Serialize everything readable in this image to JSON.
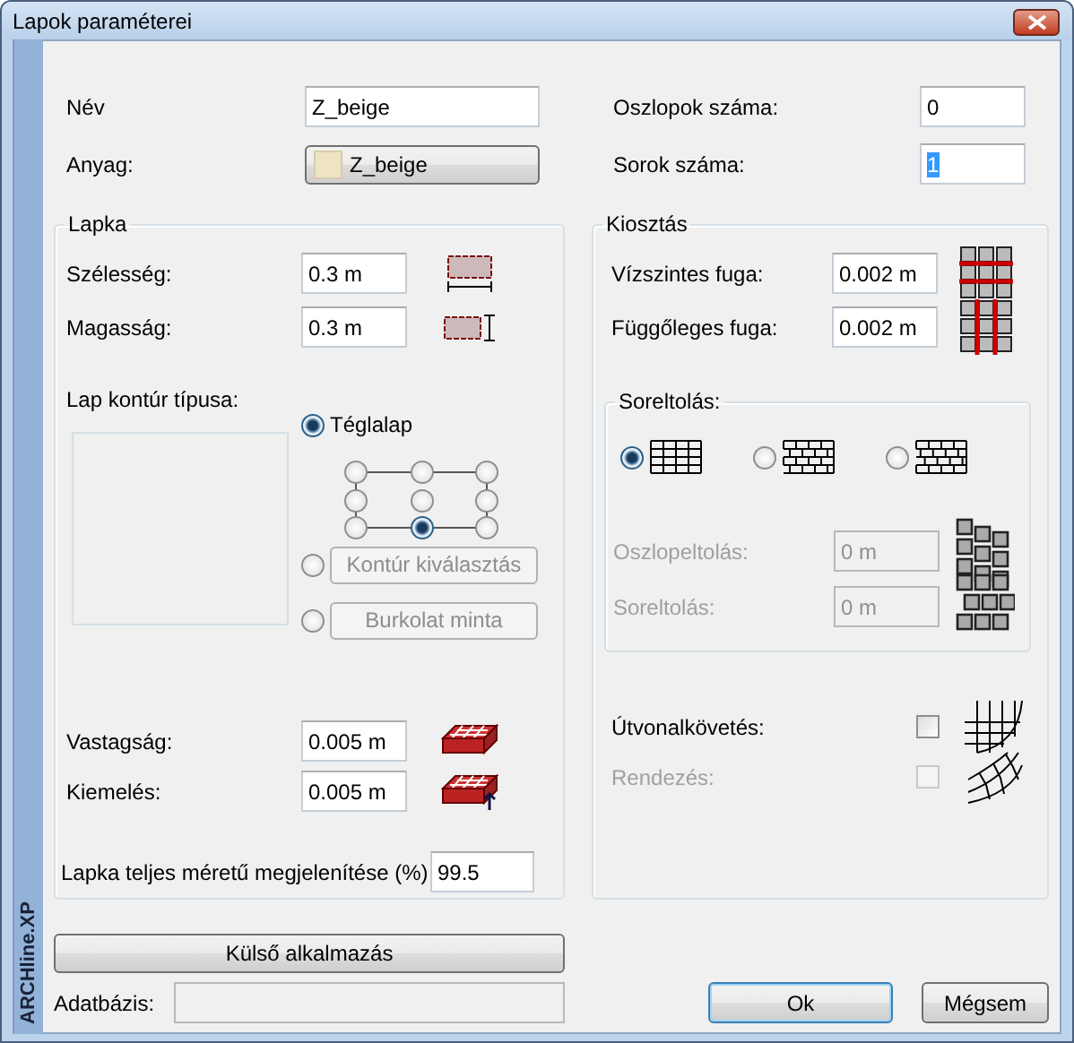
{
  "window": {
    "title": "Lapok paraméterei"
  },
  "side_label": "ARCHline.XP",
  "name_field": {
    "label": "Név",
    "value": "Z_beige"
  },
  "material": {
    "label": "Anyag:",
    "button": "Z_beige"
  },
  "columns_count": {
    "label": "Oszlopok száma:",
    "value": "0"
  },
  "rows_count": {
    "label": "Sorok száma:",
    "value": "1",
    "selected": true
  },
  "tile": {
    "title": "Lapka",
    "fields": [
      {
        "kind": "width",
        "label": "Szélesség:",
        "value": "0.3 m"
      },
      {
        "kind": "height",
        "label": "Magasság:",
        "value": "0.3 m"
      }
    ],
    "contour": {
      "label": "Lap kontúr típusa:",
      "shapes": [
        {
          "kind": "text",
          "label": "Téglalap",
          "selected": true,
          "disabled": false
        },
        {
          "kind": "button",
          "label": "Kontúr kiválasztás",
          "selected": false,
          "disabled": true
        },
        {
          "kind": "button",
          "label": "Burkolat minta",
          "selected": false,
          "disabled": true
        }
      ],
      "anchors": [
        {
          "selected": false
        },
        {
          "selected": false
        },
        {
          "selected": false
        },
        {
          "selected": false
        },
        {
          "selected": false
        },
        {
          "selected": false
        },
        {
          "selected": false
        },
        {
          "selected": true
        },
        {
          "selected": false
        }
      ]
    },
    "depth_fields": [
      {
        "kind": "thickness",
        "label": "Vastagság:",
        "value": "0.005 m"
      },
      {
        "kind": "elevation",
        "label": "Kiemelés:",
        "value": "0.005 m"
      }
    ],
    "full_size": {
      "label": "Lapka teljes méretű megjelenítése (%)",
      "value": "99.5"
    }
  },
  "layout": {
    "title": "Kiosztás",
    "joints": [
      {
        "kind": "horizontal",
        "label": "Vízszintes fuga:",
        "value": "0.002 m"
      },
      {
        "kind": "vertical",
        "label": "Függőleges fuga:",
        "value": "0.002 m"
      }
    ],
    "offset": {
      "title": "Soreltolás:",
      "patterns": [
        {
          "kind": "grid",
          "selected": true
        },
        {
          "kind": "half",
          "selected": false
        },
        {
          "kind": "third",
          "selected": false
        }
      ],
      "fields": [
        {
          "kind": "column",
          "label": "Oszlopeltolás:",
          "value": "0 m",
          "disabled": true
        },
        {
          "kind": "row",
          "label": "Soreltolás:",
          "value": "0 m",
          "disabled": true
        }
      ]
    },
    "options": [
      {
        "kind": "path",
        "label": "Útvonalkövetés:",
        "checked": false,
        "disabled": false
      },
      {
        "kind": "arrange",
        "label": "Rendezés:",
        "checked": false,
        "disabled": true
      }
    ]
  },
  "external_button": "Külső alkalmazás",
  "database": {
    "label": "Adatbázis:"
  },
  "buttons": [
    {
      "label": "Ok",
      "default": true
    },
    {
      "label": "Mégsem",
      "default": false
    }
  ]
}
